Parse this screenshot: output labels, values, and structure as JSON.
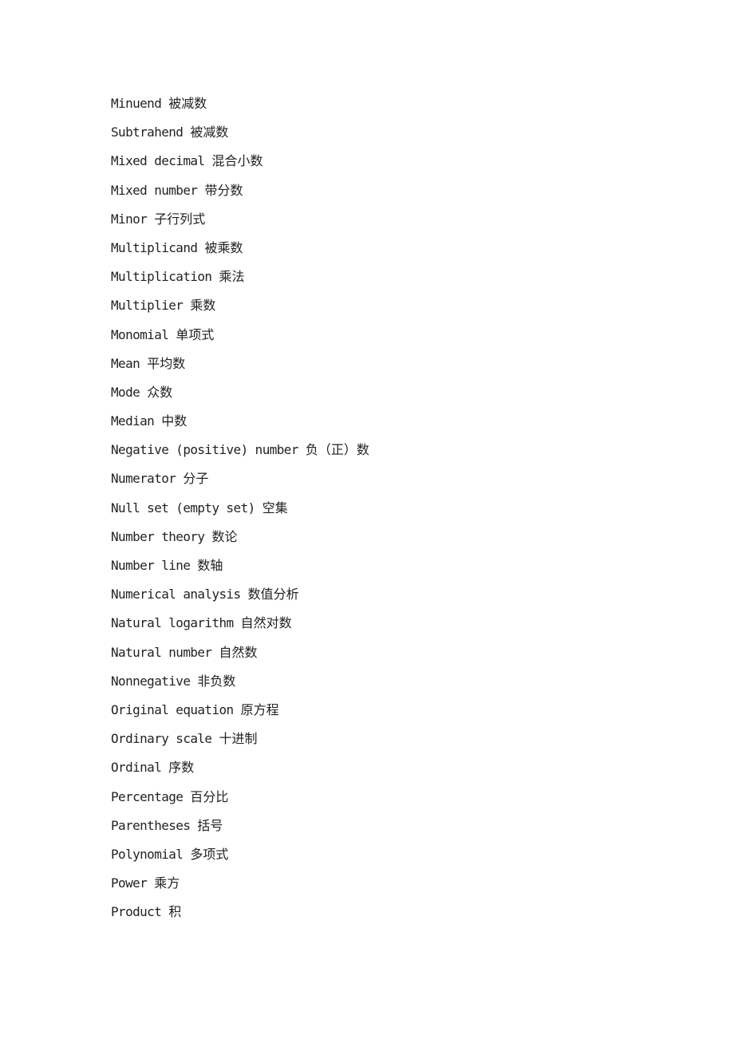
{
  "entries": [
    {
      "en": "Minuend",
      "zh": "被减数"
    },
    {
      "en": "Subtrahend",
      "zh": "被减数"
    },
    {
      "en": "Mixed decimal",
      "zh": "混合小数"
    },
    {
      "en": "Mixed number",
      "zh": "带分数"
    },
    {
      "en": "Minor",
      "zh": "子行列式"
    },
    {
      "en": "Multiplicand",
      "zh": "被乘数"
    },
    {
      "en": "Multiplication",
      "zh": "乘法"
    },
    {
      "en": "Multiplier",
      "zh": "乘数"
    },
    {
      "en": "Monomial",
      "zh": "单项式"
    },
    {
      "en": "Mean",
      "zh": "平均数"
    },
    {
      "en": "Mode",
      "zh": "众数"
    },
    {
      "en": "Median",
      "zh": "中数"
    },
    {
      "en": "Negative (positive) number",
      "zh": "负（正）数"
    },
    {
      "en": "Numerator",
      "zh": "分子"
    },
    {
      "en": "Null set (empty set)",
      "zh": "空集"
    },
    {
      "en": "Number theory",
      "zh": "数论"
    },
    {
      "en": "Number line",
      "zh": "数轴"
    },
    {
      "en": "Numerical analysis",
      "zh": "数值分析"
    },
    {
      "en": "Natural logarithm",
      "zh": "自然对数"
    },
    {
      "en": "Natural number",
      "zh": "自然数"
    },
    {
      "en": "Nonnegative",
      "zh": "非负数"
    },
    {
      "en": "Original equation",
      "zh": "原方程"
    },
    {
      "en": "Ordinary scale",
      "zh": "十进制"
    },
    {
      "en": "Ordinal",
      "zh": "序数"
    },
    {
      "en": "Percentage",
      "zh": "百分比"
    },
    {
      "en": "Parentheses",
      "zh": "括号"
    },
    {
      "en": "Polynomial",
      "zh": "多项式"
    },
    {
      "en": "Power",
      "zh": "乘方"
    },
    {
      "en": "Product",
      "zh": "积"
    }
  ]
}
